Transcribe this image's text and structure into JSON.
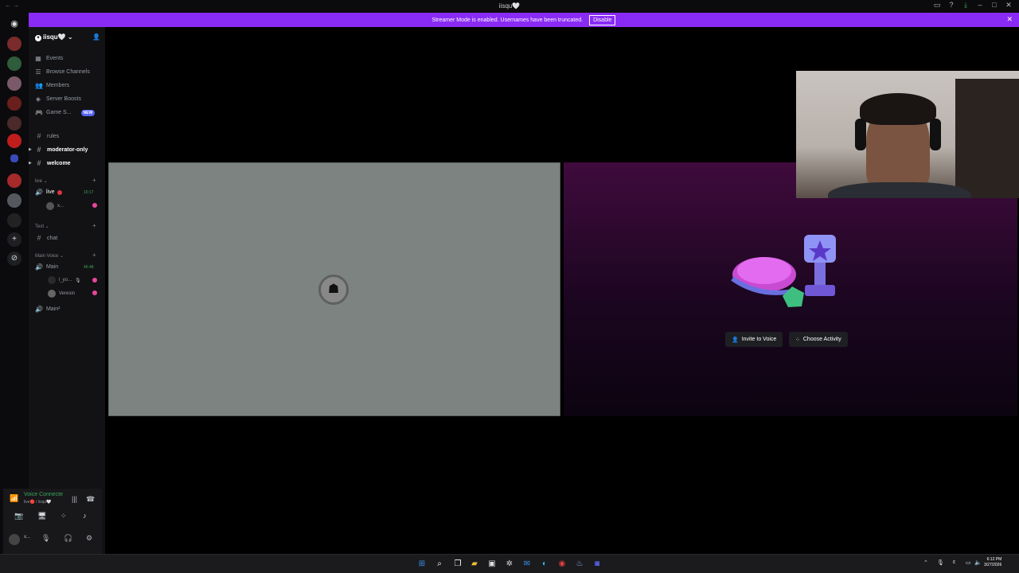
{
  "window": {
    "title": "iisqu🤍",
    "nav": "← →"
  },
  "banner": {
    "text": "Streamer Mode is enabled. Usernames have been truncated.",
    "button": "Disable"
  },
  "server": {
    "name": "iisqu🤍",
    "nav_items": [
      {
        "label": "Events",
        "icon": "calendar-icon"
      },
      {
        "label": "Browse Channels",
        "icon": "browse-icon"
      },
      {
        "label": "Members",
        "icon": "members-icon"
      },
      {
        "label": "Server Boosts",
        "icon": "boost-icon"
      },
      {
        "label": "Game S...",
        "icon": "gamepad-icon",
        "badge": "NEW"
      }
    ],
    "channels_top": [
      {
        "name": "rules"
      },
      {
        "name": "moderator-only"
      },
      {
        "name": "welcome"
      }
    ],
    "categories": {
      "live": "live",
      "text": "Text",
      "main_voice": "Main Voice"
    },
    "live_channel": {
      "name": "live",
      "timer": "10:17",
      "member": "x..."
    },
    "text_channel": {
      "name": "chat"
    },
    "main_channel": {
      "name": "Main",
      "timer": "46:48",
      "members": [
        "l_yo...",
        "Veresin"
      ]
    },
    "main2_channel": {
      "name": "Main²"
    }
  },
  "voice_panel": {
    "status": "Voice Connecte",
    "sub": "live🔴 / iisqu🤍",
    "user": "x..."
  },
  "activity": {
    "invite_label": "Invite to Voice",
    "choose_label": "Choose Activity"
  },
  "taskbar": {
    "time": "6:12 PM",
    "date": "3/27/2026"
  },
  "colors": {
    "accent": "#8a2bf5",
    "online": "#3ba55c",
    "blurple": "#5865f2"
  }
}
